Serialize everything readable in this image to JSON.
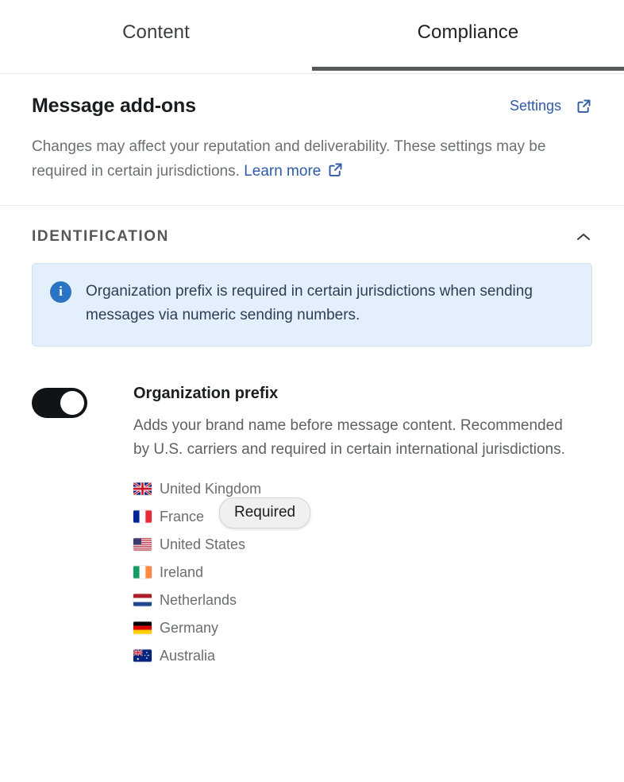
{
  "tabs": [
    {
      "label": "Content",
      "active": false
    },
    {
      "label": "Compliance",
      "active": true
    }
  ],
  "header": {
    "title": "Message add-ons",
    "settings_label": "Settings",
    "settings_icon": "external-link-icon",
    "description_part1": "Changes may affect your reputation and deliverability. These settings may be required in certain jurisdictions.",
    "learn_more_label": "Learn more",
    "learn_more_icon": "external-link-icon"
  },
  "section": {
    "title": "IDENTIFICATION",
    "collapse_icon": "chevron-up-icon",
    "expanded": true
  },
  "banner": {
    "icon": "info-circle-icon",
    "text": "Organization prefix is required in certain jurisdictions when sending messages via numeric sending numbers."
  },
  "setting": {
    "toggle_state": "on",
    "title": "Organization prefix",
    "description": "Adds your brand name before message content. Recommended by U.S. carriers and required in certain international jurisdictions.",
    "countries": [
      {
        "name": "United Kingdom",
        "flag": "gb"
      },
      {
        "name": "France",
        "flag": "fr"
      },
      {
        "name": "United States",
        "flag": "us"
      },
      {
        "name": "Ireland",
        "flag": "ie"
      },
      {
        "name": "Netherlands",
        "flag": "nl"
      },
      {
        "name": "Germany",
        "flag": "de"
      },
      {
        "name": "Australia",
        "flag": "au"
      }
    ],
    "tooltip": {
      "label": "Required",
      "anchor_country": "France"
    }
  },
  "colors": {
    "link": "#2f5aa8",
    "banner_bg": "#e3effa",
    "banner_border": "#cfe2f3",
    "info_icon": "#2a74c4",
    "toggle_on": "#111417",
    "active_tab_underline": "#56595c"
  }
}
